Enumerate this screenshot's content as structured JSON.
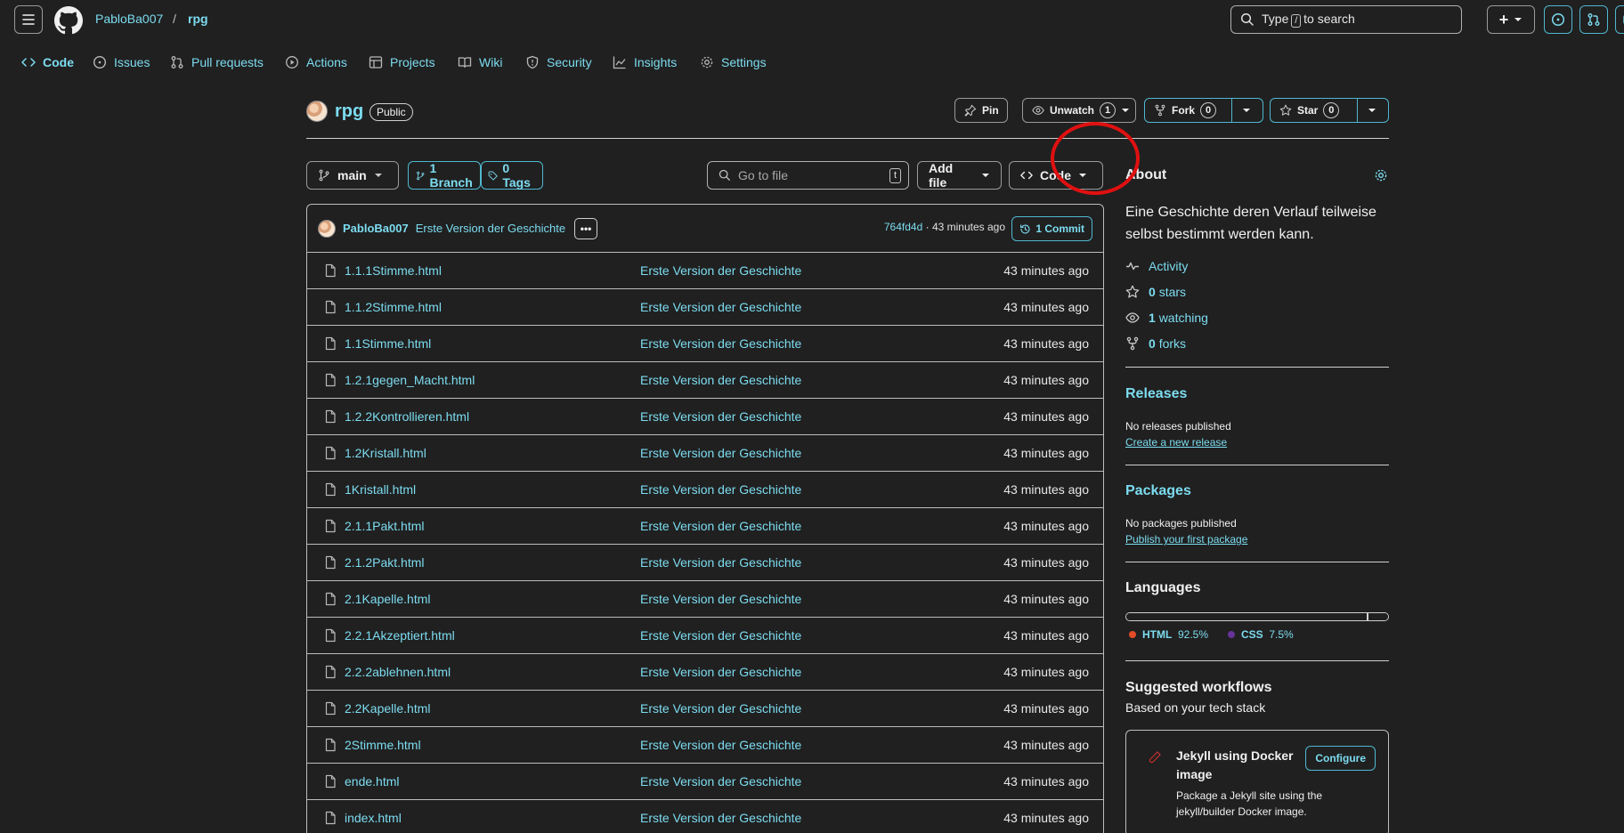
{
  "header": {
    "owner": "PabloBa007",
    "separator": "/",
    "repo": "rpg",
    "search_prefix": "Type",
    "search_key": "/",
    "search_suffix": "to search",
    "add_label": "+"
  },
  "repo_nav": [
    {
      "label": "Code",
      "icon": "code-icon"
    },
    {
      "label": "Issues",
      "icon": "issue-icon"
    },
    {
      "label": "Pull requests",
      "icon": "pull-request-icon"
    },
    {
      "label": "Actions",
      "icon": "play-icon"
    },
    {
      "label": "Projects",
      "icon": "table-icon"
    },
    {
      "label": "Wiki",
      "icon": "book-icon"
    },
    {
      "label": "Security",
      "icon": "shield-icon"
    },
    {
      "label": "Insights",
      "icon": "graph-icon"
    },
    {
      "label": "Settings",
      "icon": "gear-icon"
    }
  ],
  "repo_title": {
    "name": "rpg",
    "visibility": "Public",
    "pin_label": "Pin",
    "watch_label": "Unwatch",
    "watch_count": "1",
    "fork_label": "Fork",
    "fork_count": "0",
    "star_label": "Star",
    "star_count": "0"
  },
  "toolbar": {
    "branch": "main",
    "branches": "1 Branch",
    "tags": "0 Tags",
    "goto_placeholder": "Go to file",
    "goto_key": "t",
    "add_file": "Add file",
    "code": "Code"
  },
  "latest_commit": {
    "author": "PabloBa007",
    "message": "Erste Version der Geschichte",
    "dots": "•••",
    "sha": "764fd4d",
    "meta_sep": " · ",
    "time": "43 minutes ago",
    "count": "1 Commit"
  },
  "files": [
    {
      "name": "1.1.1Stimme.html",
      "message": "Erste Version der Geschichte",
      "time": "43 minutes ago"
    },
    {
      "name": "1.1.2Stimme.html",
      "message": "Erste Version der Geschichte",
      "time": "43 minutes ago"
    },
    {
      "name": "1.1Stimme.html",
      "message": "Erste Version der Geschichte",
      "time": "43 minutes ago"
    },
    {
      "name": "1.2.1gegen_Macht.html",
      "message": "Erste Version der Geschichte",
      "time": "43 minutes ago"
    },
    {
      "name": "1.2.2Kontrollieren.html",
      "message": "Erste Version der Geschichte",
      "time": "43 minutes ago"
    },
    {
      "name": "1.2Kristall.html",
      "message": "Erste Version der Geschichte",
      "time": "43 minutes ago"
    },
    {
      "name": "1Kristall.html",
      "message": "Erste Version der Geschichte",
      "time": "43 minutes ago"
    },
    {
      "name": "2.1.1Pakt.html",
      "message": "Erste Version der Geschichte",
      "time": "43 minutes ago"
    },
    {
      "name": "2.1.2Pakt.html",
      "message": "Erste Version der Geschichte",
      "time": "43 minutes ago"
    },
    {
      "name": "2.1Kapelle.html",
      "message": "Erste Version der Geschichte",
      "time": "43 minutes ago"
    },
    {
      "name": "2.2.1Akzeptiert.html",
      "message": "Erste Version der Geschichte",
      "time": "43 minutes ago"
    },
    {
      "name": "2.2.2ablehnen.html",
      "message": "Erste Version der Geschichte",
      "time": "43 minutes ago"
    },
    {
      "name": "2.2Kapelle.html",
      "message": "Erste Version der Geschichte",
      "time": "43 minutes ago"
    },
    {
      "name": "2Stimme.html",
      "message": "Erste Version der Geschichte",
      "time": "43 minutes ago"
    },
    {
      "name": "ende.html",
      "message": "Erste Version der Geschichte",
      "time": "43 minutes ago"
    },
    {
      "name": "index.html",
      "message": "Erste Version der Geschichte",
      "time": "43 minutes ago"
    }
  ],
  "sidebar": {
    "about_title": "About",
    "description": "Eine Geschichte deren Verlauf teilweise selbst bestimmt werden kann.",
    "activity": "Activity",
    "stars_count": "0",
    "stars_label": "stars",
    "watching_count": "1",
    "watching_label": "watching",
    "forks_count": "0",
    "forks_label": "forks",
    "releases_title": "Releases",
    "releases_none": "No releases published",
    "releases_link": "Create a new release",
    "packages_title": "Packages",
    "packages_none": "No packages published",
    "packages_link": "Publish your first package",
    "languages_title": "Languages",
    "languages": [
      {
        "name": "HTML",
        "percent": "92.5%",
        "value": 92.5,
        "color": "#e34c26"
      },
      {
        "name": "CSS",
        "percent": "7.5%",
        "value": 7.5,
        "color": "#663399"
      }
    ],
    "workflows_title": "Suggested workflows",
    "workflows_sub": "Based on your tech stack",
    "workflow": {
      "title": "Jekyll using Docker image",
      "description": "Package a Jekyll site using the jekyll/builder Docker image.",
      "button": "Configure"
    }
  },
  "colors": {
    "background": "#202020",
    "link": "#7cdcf0",
    "annotation": "#e01010"
  }
}
